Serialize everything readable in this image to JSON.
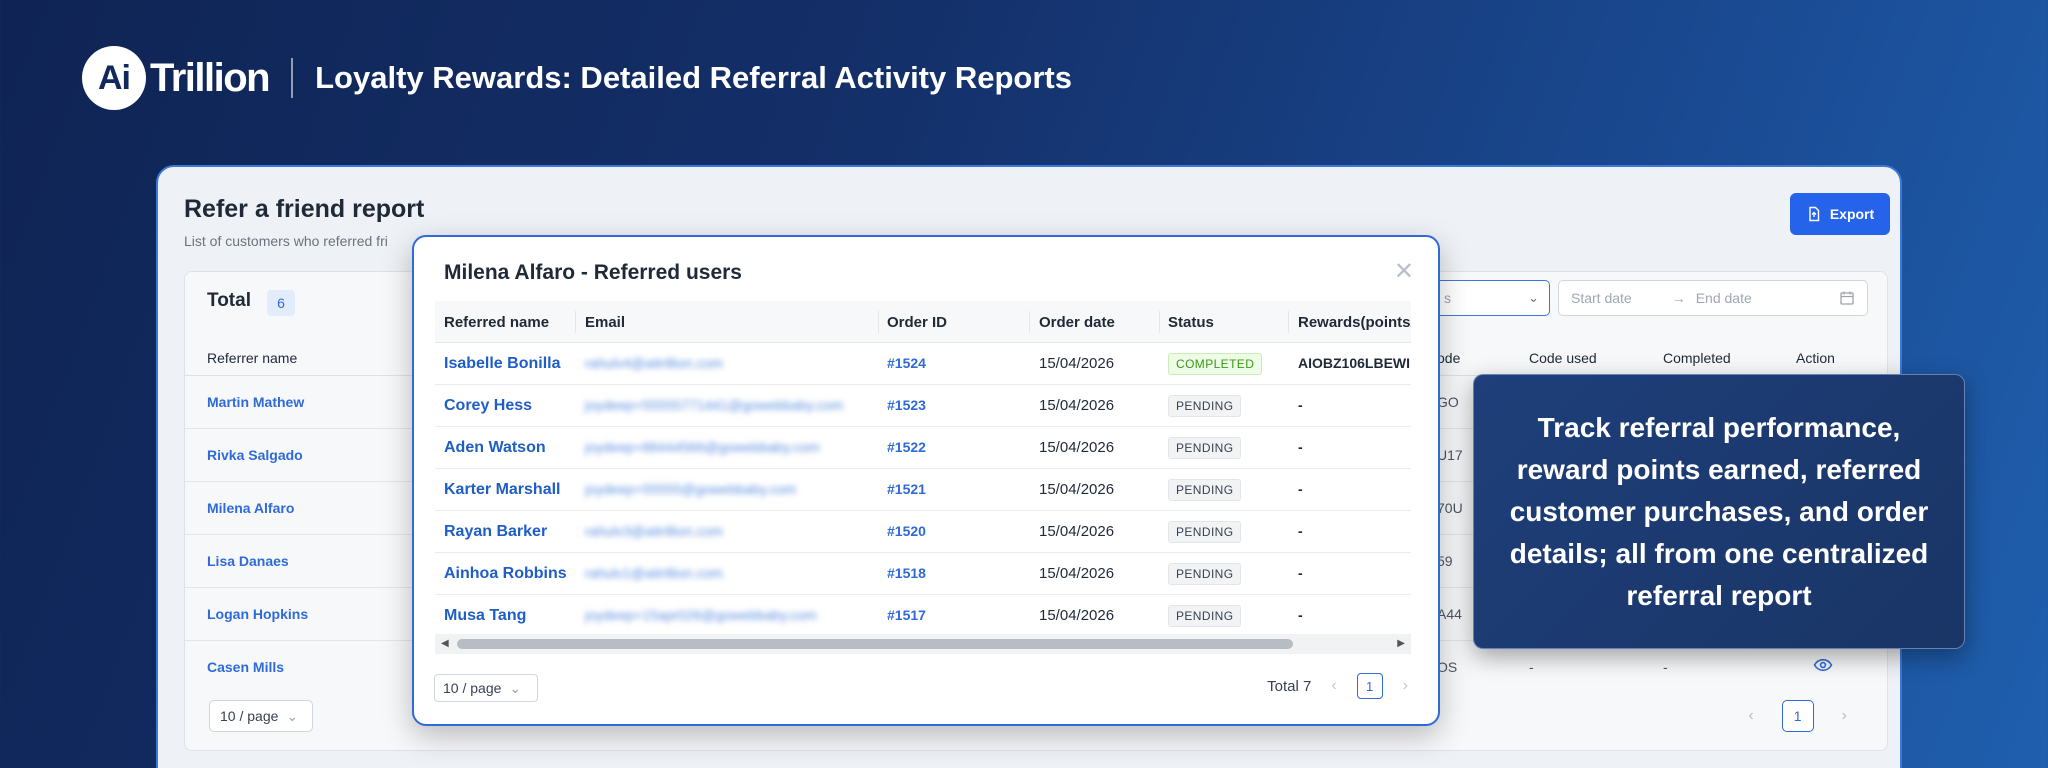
{
  "banner": {
    "logo_mark": "Ai",
    "logo_word": "Trillion",
    "title": "Loyalty Rewards: Detailed Referral Activity Reports"
  },
  "report": {
    "title": "Refer a friend report",
    "subtitle": "List of customers who referred fri",
    "export_label": "Export",
    "total_label": "Total",
    "total_count": "6",
    "filter_placeholder": "s",
    "start_date_placeholder": "Start date",
    "end_date_placeholder": "End date",
    "columns": {
      "referrer_name": "Referrer name",
      "code": "ode",
      "code_used": "Code used",
      "completed": "Completed",
      "action": "Action"
    },
    "rows": [
      {
        "referrer": "Martin Mathew",
        "code": "GO"
      },
      {
        "referrer": "Rivka Salgado",
        "code": "U17"
      },
      {
        "referrer": "Milena Alfaro",
        "code": "70U"
      },
      {
        "referrer": "Lisa Danaes",
        "code": "59"
      },
      {
        "referrer": "Logan Hopkins",
        "code": "A44"
      },
      {
        "referrer": "Casen Mills",
        "code": "OS",
        "code_used": "-",
        "completed": "-"
      }
    ],
    "page_size": "10 / page",
    "current_page": "1"
  },
  "modal": {
    "title": "Milena Alfaro - Referred users",
    "columns": {
      "name": "Referred name",
      "email": "Email",
      "order_id": "Order ID",
      "order_date": "Order date",
      "status": "Status",
      "rewards": "Rewards(points/"
    },
    "rows": [
      {
        "name": "Isabelle Bonilla",
        "email": "rahulv4@aitrillion.com",
        "order_id": "#1524",
        "order_date": "15/04/2026",
        "status": "COMPLETED",
        "reward": "AIOBZ106LBEWI"
      },
      {
        "name": "Corey Hess",
        "email": "joydeep+55555771441@gowebbaby.com",
        "order_id": "#1523",
        "order_date": "15/04/2026",
        "status": "PENDING",
        "reward": "-"
      },
      {
        "name": "Aden Watson",
        "email": "joydeep+88444566@gowebbaby.com",
        "order_id": "#1522",
        "order_date": "15/04/2026",
        "status": "PENDING",
        "reward": "-"
      },
      {
        "name": "Karter Marshall",
        "email": "joydeep+55555@gowebbaby.com",
        "order_id": "#1521",
        "order_date": "15/04/2026",
        "status": "PENDING",
        "reward": "-"
      },
      {
        "name": "Rayan Barker",
        "email": "rahulv3@aitrillion.com",
        "order_id": "#1520",
        "order_date": "15/04/2026",
        "status": "PENDING",
        "reward": "-"
      },
      {
        "name": "Ainhoa Robbins",
        "email": "rahulv1@aitrillion.com",
        "order_id": "#1518",
        "order_date": "15/04/2026",
        "status": "PENDING",
        "reward": "-"
      },
      {
        "name": "Musa Tang",
        "email": "joydeep+15apr026@gowebbaby.com",
        "order_id": "#1517",
        "order_date": "15/04/2026",
        "status": "PENDING",
        "reward": "-"
      }
    ],
    "page_size": "10 / page",
    "total_text": "Total 7",
    "current_page": "1"
  },
  "callout": {
    "text": "Track referral performance, reward points earned, referred customer purchases, and order details; all from one centralized referral report"
  },
  "colors": {
    "accent": "#2f6ad8",
    "completed": "#3a9b18",
    "callout_bg": "#1e3f7a"
  }
}
